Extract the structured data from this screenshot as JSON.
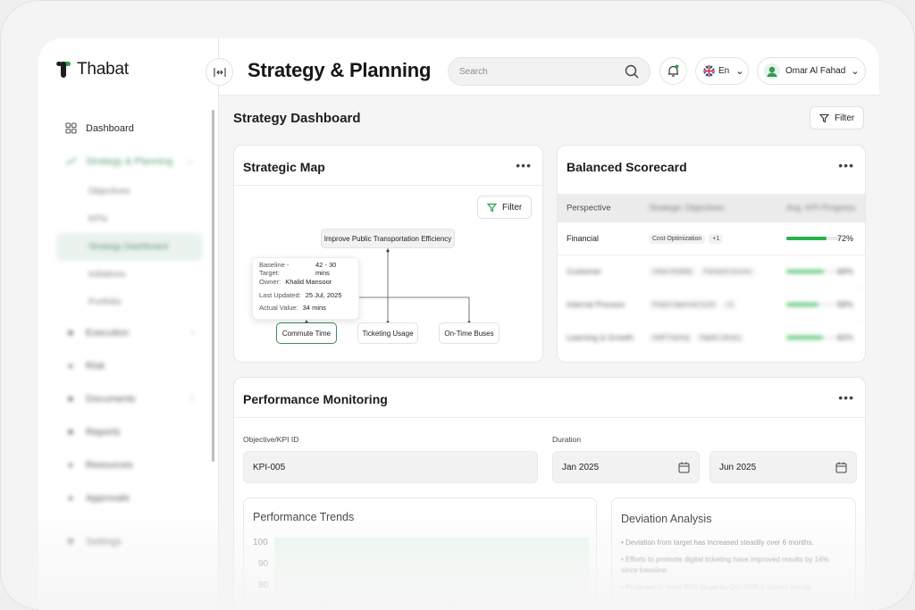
{
  "app": {
    "name": "Thabat",
    "brand_color": "#2e9e4f"
  },
  "header": {
    "title": "Strategy & Planning",
    "search_placeholder": "Search",
    "language": "En",
    "user_name": "Omar Al Fahad"
  },
  "sidebar": {
    "items": [
      {
        "label": "Dashboard",
        "icon": "grid-icon"
      },
      {
        "label": "Strategy & Planning",
        "icon": "chart-icon"
      },
      {
        "label": "Execution",
        "icon": "folder-icon"
      },
      {
        "label": "Risk",
        "icon": "risk-icon"
      },
      {
        "label": "Documents",
        "icon": "document-icon"
      },
      {
        "label": "Reports",
        "icon": "report-icon"
      },
      {
        "label": "Resources",
        "icon": "resource-icon"
      },
      {
        "label": "Approvals",
        "icon": "approval-icon"
      },
      {
        "label": "Settings",
        "icon": "gear-icon"
      }
    ],
    "sub_items": [
      "Objectives",
      "KPIs",
      "Strategy Dashboard",
      "Initiatives",
      "Portfolio"
    ]
  },
  "main": {
    "section_title": "Strategy Dashboard",
    "filter_label": "Filter",
    "strategic_map": {
      "title": "Strategic Map",
      "filter_label": "Filter",
      "root": "Improve Public Transportation Efficiency",
      "children": [
        "Commute Time",
        "Ticketing Usage",
        "On-Time Buses"
      ],
      "tooltip": {
        "baseline_label": "Baseline - Target:",
        "baseline_value": "42 - 30 mins",
        "owner_label": "Owner:",
        "owner_value": "Khalid Mansoor",
        "updated_label": "Last Updated:",
        "updated_value": "25 Jul, 2025",
        "actual_label": "Actual Value:",
        "actual_value": "34 mins"
      }
    },
    "balanced_scorecard": {
      "title": "Balanced Scorecard",
      "columns": [
        "Perspective",
        "Strategic Objectives",
        "Avg. KPI Progress"
      ],
      "rows": [
        {
          "perspective": "Financial",
          "objective": "Cost Optimization",
          "extra": "+1",
          "progress": 72,
          "progress_label": "72%"
        },
        {
          "perspective": "Customer",
          "objective": "Urban Mobility",
          "extra": "Transport Access",
          "progress": 68,
          "progress_label": "68%"
        },
        {
          "perspective": "Internal Process",
          "objective": "Project Approval Cycle",
          "extra": "+2",
          "progress": 58,
          "progress_label": "58%"
        },
        {
          "perspective": "Learning & Growth",
          "objective": "Staff Training",
          "extra": "Digital Literacy",
          "progress": 66,
          "progress_label": "66%"
        }
      ]
    },
    "performance_monitoring": {
      "title": "Performance Monitoring",
      "kpi_label": "Objective/KPI ID",
      "kpi_value": "KPI-005",
      "duration_label": "Duration",
      "from": "Jan 2025",
      "to": "Jun 2025",
      "trends_title": "Performance Trends",
      "y_ticks": [
        "100",
        "90",
        "80"
      ],
      "deviation_title": "Deviation Analysis",
      "deviation_points": [
        "Deviation from target has increased steadily over 6 months.",
        "Efforts to promote digital ticketing have improved results by 14% since baseline.",
        "Projected to meet 90% target by Oct 2025 if current trends"
      ]
    }
  }
}
